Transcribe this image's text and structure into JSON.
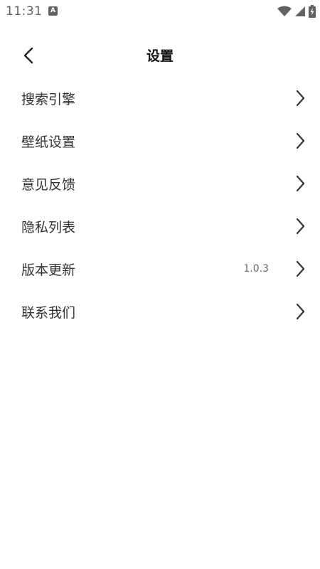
{
  "status_bar": {
    "time": "11:31",
    "notification_glyph": "A",
    "icons": [
      "wifi-icon",
      "cell-signal-icon",
      "battery-charging-icon"
    ]
  },
  "header": {
    "back_icon": "chevron-left-icon",
    "title": "设置"
  },
  "settings": {
    "items": [
      {
        "label": "搜索引擎",
        "value": ""
      },
      {
        "label": "壁纸设置",
        "value": ""
      },
      {
        "label": "意见反馈",
        "value": ""
      },
      {
        "label": "隐私列表",
        "value": ""
      },
      {
        "label": "版本更新",
        "value": "1.0.3"
      },
      {
        "label": "联系我们",
        "value": ""
      }
    ],
    "chevron_icon": "chevron-right-icon"
  },
  "colors": {
    "background": "#ffffff",
    "title": "#111111",
    "label": "#333333",
    "secondary": "#666666",
    "icon": "#333333"
  }
}
